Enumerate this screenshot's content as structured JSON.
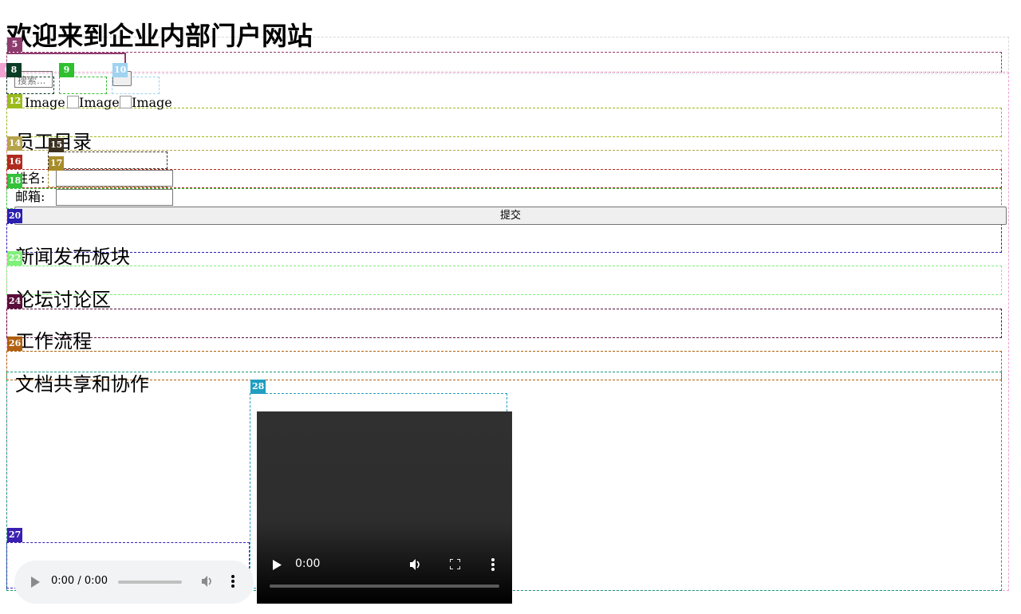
{
  "page": {
    "title": "欢迎来到企业内部门户网站",
    "search_placeholder": "搜索..."
  },
  "images": [
    "Image",
    "Image",
    "Image"
  ],
  "directory": {
    "heading": "员工目录",
    "name_label": "姓名:",
    "email_label": "邮箱:",
    "submit_label": "提交"
  },
  "sections": {
    "news": "新闻发布板块",
    "forum": "论坛讨论区",
    "workflow": "工作流程",
    "docs": "文档共享和协作"
  },
  "video": {
    "time": "0:00"
  },
  "audio": {
    "time": "0:00 / 0:00"
  },
  "markers": [
    {
      "id": "5",
      "color": "#8e3b6e"
    },
    {
      "id": "6",
      "color": "#f0a3d0"
    },
    {
      "id": "8",
      "color": "#0b3d26"
    },
    {
      "id": "9",
      "color": "#2fc02f"
    },
    {
      "id": "10",
      "color": "#9fd3f0"
    },
    {
      "id": "12",
      "color": "#9bbb1d"
    },
    {
      "id": "14",
      "color": "#b7a34c"
    },
    {
      "id": "15",
      "color": "#3b3020"
    },
    {
      "id": "16",
      "color": "#b02a1f"
    },
    {
      "id": "17",
      "color": "#a88c2a"
    },
    {
      "id": "18",
      "color": "#33c23a"
    },
    {
      "id": "20",
      "color": "#2b1fb0"
    },
    {
      "id": "22",
      "color": "#7ff07a"
    },
    {
      "id": "24",
      "color": "#5a0f3b"
    },
    {
      "id": "26",
      "color": "#b0600f"
    },
    {
      "id": "27",
      "color": "#3a1fb0"
    },
    {
      "id": "28",
      "color": "#1f9ec0"
    }
  ]
}
